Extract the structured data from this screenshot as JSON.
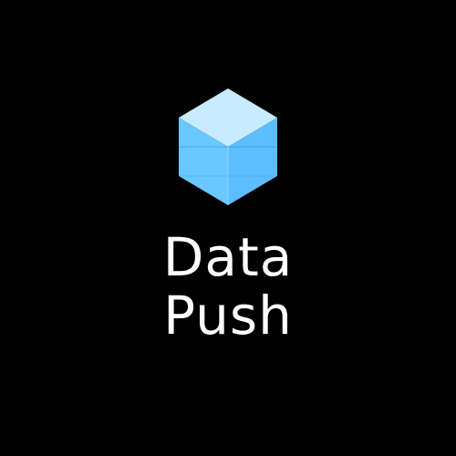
{
  "logo": {
    "icon_name": "cube-icon",
    "colors": {
      "top": "#c8ecff",
      "left": "#69c8ff",
      "right": "#5cbeff",
      "edge": "#8fd6ff",
      "seam": "#3aa6e6"
    }
  },
  "wordmark": {
    "line1": "Data",
    "line2": "Push",
    "color": "#ffffff"
  },
  "background": "#000000"
}
